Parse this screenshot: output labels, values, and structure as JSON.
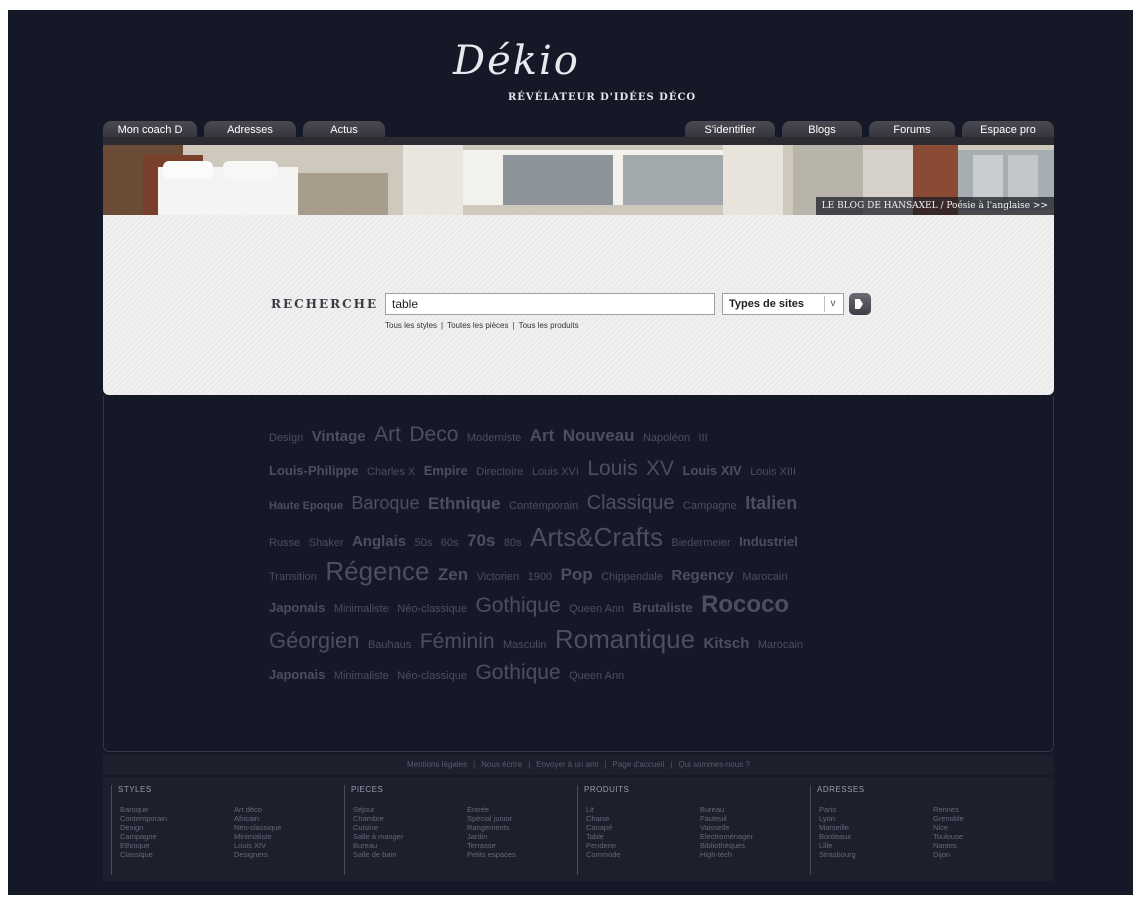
{
  "logo": {
    "name": "Dékio",
    "tagline": "RÉVÉLATEUR D'IDÉES DÉCO"
  },
  "nav": {
    "left": [
      "Mon coach D",
      "Adresses",
      "Actus"
    ],
    "right": [
      "S'identifier",
      "Blogs",
      "Forums",
      "Espace pro"
    ]
  },
  "banner": {
    "caption": "LE BLOG DE HANSAXEL / Poésie à l'anglaise >>"
  },
  "search": {
    "label": "RECHERCHE",
    "query": "table",
    "site_type": "Types de sites",
    "filters": [
      "Tous les styles",
      "Toutes les pièces",
      "Tous les produits"
    ]
  },
  "tag_cloud": [
    [
      "Design",
      "Vintage",
      "Art",
      "Deco",
      "Moderniste",
      "Art",
      "Nouveau",
      "Napoléon",
      "III"
    ],
    [
      "Louis-Philippe",
      "Charles X",
      "Empire",
      "Directoire",
      "Louis XVI",
      "Louis",
      "XV",
      "Louis XIV",
      "Louis XIII"
    ],
    [
      "Haute Epoque",
      "Baroque",
      "Ethnique",
      "Contemporain",
      "Classique",
      "Campagne",
      "Italien"
    ],
    [
      "Russe",
      "Shaker",
      "Anglais",
      "50s",
      "60s",
      "70s",
      "80s",
      "Arts&Crafts",
      "Biedermeier",
      "Industriel"
    ],
    [
      "Transition",
      "Régence",
      "Zen",
      "Victorien",
      "1900",
      "Pop",
      "Chippendale",
      "Regency",
      "Marocain"
    ],
    [
      "Japonais",
      "Minimaliste",
      "Néo-classique",
      "Gothique",
      "Queen Ann",
      "Brutaliste",
      "Rococo"
    ],
    [
      "Géorgien",
      "Bauhaus",
      "Féminin",
      "Masculin",
      "Romantique",
      "Kitsch",
      "Marocain"
    ],
    [
      "Japonais",
      "Minimaliste",
      "Néo-classique",
      "Gothique",
      "Queen Ann"
    ]
  ],
  "footer_links": [
    "Mentions légales",
    "Nous écrire",
    "Envoyer à un ami",
    "Page d'accueil",
    "Qui sommes-nous ?"
  ],
  "directory": {
    "styles": {
      "title": "STYLES",
      "col1": [
        "Baroque",
        "Contemporain",
        "Design",
        "Campagne",
        "Ethnique",
        "Classique"
      ],
      "col2": [
        "Art déco",
        "Africain",
        "Néo-classique",
        "Minimaliste",
        "Louis XIV",
        "Designers"
      ]
    },
    "pieces": {
      "title": "PIECES",
      "col1": [
        "Séjour",
        "Chambre",
        "Cuisine",
        "Salle à manger",
        "Bureau",
        "Salle de bain"
      ],
      "col2": [
        "Entrée",
        "Spécial junior",
        "Rangements",
        "Jardin",
        "Terrasse",
        "Petits espaces"
      ]
    },
    "produits": {
      "title": "PRODUITS",
      "col1": [
        "Lit",
        "Chaise",
        "Canapé",
        "Table",
        "Penderie",
        "Commode"
      ],
      "col2": [
        "Bureau",
        "Fauteuil",
        "Vaisselle",
        "Electroménager",
        "Bibliothèques",
        "High-tech"
      ]
    },
    "adresses": {
      "title": "ADRESSES",
      "col1": [
        "Paris",
        "Lyon",
        "Marseille",
        "Bordeaux",
        "Lille",
        "Strasbourg"
      ],
      "col2": [
        "Rennes",
        "Grenoble",
        "Nice",
        "Toulouse",
        "Nantes",
        "Dijon"
      ]
    }
  }
}
